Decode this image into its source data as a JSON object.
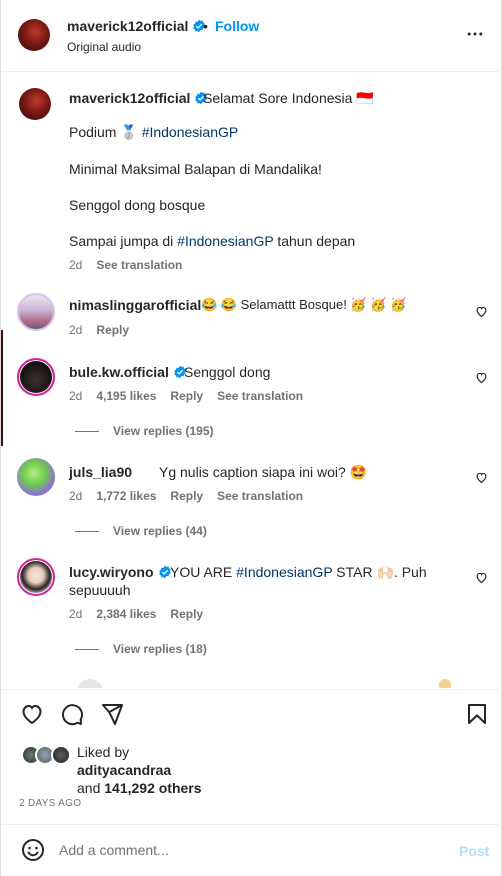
{
  "header": {
    "username": "maverick12official",
    "separator": "•",
    "follow_label": "Follow",
    "subtitle": "Original audio"
  },
  "caption": {
    "username": "maverick12official",
    "line1": "Selamat Sore Indonesia 🇮🇩",
    "line2_text": "Podium 🥈 ",
    "line2_hashtag": "#IndonesianGP",
    "line3": "Minimal Maksimal Balapan di Mandalika!",
    "line4": "Senggol dong bosque",
    "line5_text": "Sampai jumpa di ",
    "line5_hashtag": "#IndonesianGP",
    "line5_tail": " tahun depan",
    "time": "2d",
    "translate_label": "See translation"
  },
  "comments": [
    {
      "username": "nimaslinggarofficial",
      "text": "😂 😂  Selamattt Bosque! 🥳 🥳 🥳",
      "time": "2d",
      "reply_label": "Reply"
    },
    {
      "username": "bule.kw.official",
      "text": "Senggol dong",
      "time": "2d",
      "likes": "4,195 likes",
      "reply_label": "Reply",
      "translate_label": "See translation",
      "view_replies": "View replies (195)"
    },
    {
      "username": "juls_lia90",
      "text": "Yg nulis caption siapa ini woi? 🤩",
      "time": "2d",
      "likes": "1,772 likes",
      "reply_label": "Reply",
      "translate_label": "See translation",
      "view_replies": "View replies (44)"
    },
    {
      "username": "lucy.wiryono",
      "text_a": "YOU ARE ",
      "hashtag": "#IndonesianGP",
      "text_b": " STAR 🙌🏻. Puh",
      "text_line2": "sepuuuuh",
      "time": "2d",
      "likes": "2,384 likes",
      "reply_label": "Reply",
      "view_replies": "View replies (18)"
    }
  ],
  "likes": {
    "liked_by_label": "Liked by",
    "liked_user": "adityacandraa",
    "others_prefix": "and ",
    "others_count": "141,292 others"
  },
  "date": "2 DAYS AGO",
  "comment_input": {
    "placeholder": "Add a comment...",
    "post_label": "Post"
  },
  "icons": {
    "more": "more-horizontal-icon",
    "like": "heart-icon",
    "comment": "comment-icon",
    "share": "share-icon",
    "save": "bookmark-icon",
    "emoji": "emoji-icon"
  },
  "colors": {
    "accent": "#0095f6",
    "hashtag": "#00376b",
    "muted": "#737373",
    "post_disabled": "#b2dffc"
  }
}
